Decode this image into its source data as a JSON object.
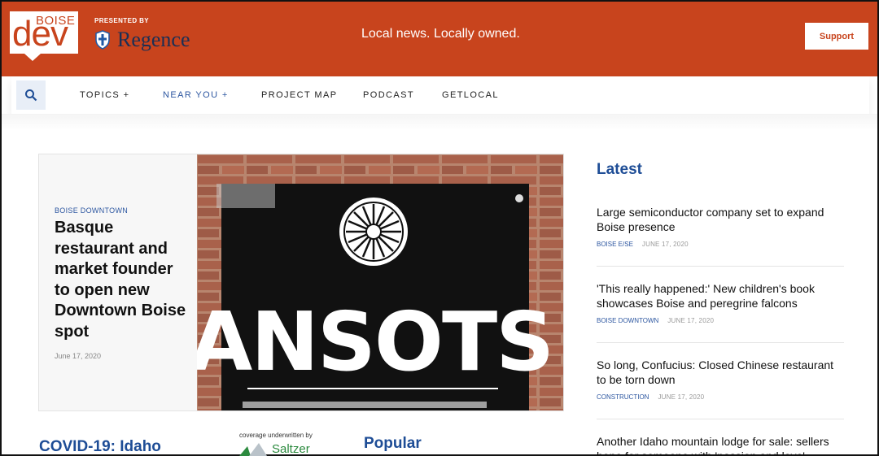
{
  "header": {
    "logo_small": "BOISE",
    "logo_big": "dev",
    "presented_by": "PRESENTED BY",
    "sponsor": "Regence",
    "tagline": "Local news. Locally owned.",
    "support_label": "Support",
    "brand_color": "#c8441d"
  },
  "nav": {
    "search_icon": "search-icon",
    "items": [
      {
        "label": "TOPICS +"
      },
      {
        "label": "NEAR YOU +"
      },
      {
        "label": "PROJECT MAP"
      },
      {
        "label": "PODCAST"
      },
      {
        "label": "GETLOCAL"
      }
    ]
  },
  "feature": {
    "kicker": "BOISE DOWNTOWN",
    "headline": "Basque restaurant and market founder to open new Downtown Boise spot",
    "date": "June 17, 2020",
    "sign_text": "ANSOTS"
  },
  "latest": {
    "title": "Latest",
    "stories": [
      {
        "title": "Large semiconductor company set to expand Boise presence",
        "category": "BOISE E/SE",
        "date": "JUNE 17, 2020"
      },
      {
        "title": "'This really happened:' New children's book showcases Boise and peregrine falcons",
        "category": "BOISE DOWNTOWN",
        "date": "JUNE 17, 2020"
      },
      {
        "title": "So long, Confucius: Closed Chinese restaurant to be torn down",
        "category": "CONSTRUCTION",
        "date": "JUNE 17, 2020"
      },
      {
        "title": "Another Idaho mountain lodge for sale: sellers hope for someone with 'passion and love'",
        "category": "",
        "date": ""
      }
    ]
  },
  "lower": {
    "covid_title": "COVID-19: Idaho",
    "underwritten": "coverage underwritten by",
    "underwriter": "Saltzer",
    "popular_title": "Popular"
  }
}
